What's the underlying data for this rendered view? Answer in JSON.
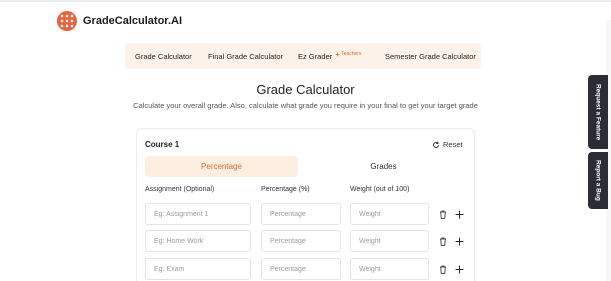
{
  "brand": {
    "name": "GradeCalculator.AI",
    "logo_icon": "dotted-circle-logo",
    "accent": "#e8633b"
  },
  "nav": {
    "items": [
      {
        "label": "Grade Calculator"
      },
      {
        "label": "Final Grade Calculator"
      },
      {
        "label": "Ez Grader",
        "badge": "Teachers",
        "badge_icon": "sparkle-icon"
      },
      {
        "label": "Semester Grade Calculator"
      }
    ],
    "background": "#fdf2ea"
  },
  "page": {
    "title": "Grade Calculator",
    "subtitle": "Calculate your overall grade. Also, calculate what grade you require in your final to get your target grade"
  },
  "course": {
    "title": "Course 1",
    "reset_label": "Reset",
    "tabs": {
      "percentage": "Percentage",
      "grades": "Grades"
    },
    "active_tab": "Percentage",
    "columns": {
      "assignment": "Assignment (Optional)",
      "percentage": "Percentage (%)",
      "weight": "Weight (out of 100)"
    },
    "rows": [
      {
        "assignment_placeholder": "Eg: Assignment 1",
        "percentage_placeholder": "Percentage",
        "weight_placeholder": "Weight"
      },
      {
        "assignment_placeholder": "Eg: Home Work",
        "percentage_placeholder": "Percentage",
        "weight_placeholder": "Weight"
      },
      {
        "assignment_placeholder": "Eg: Exam",
        "percentage_placeholder": "Percentage",
        "weight_placeholder": "Weight"
      }
    ]
  },
  "side_tabs": {
    "feature": "Request a Feature",
    "bug": "Report a Bug"
  },
  "colors": {
    "active_tab_bg": "#fdeee1",
    "active_tab_text": "#d5702f",
    "side_tab_bg": "#2b2c34"
  }
}
